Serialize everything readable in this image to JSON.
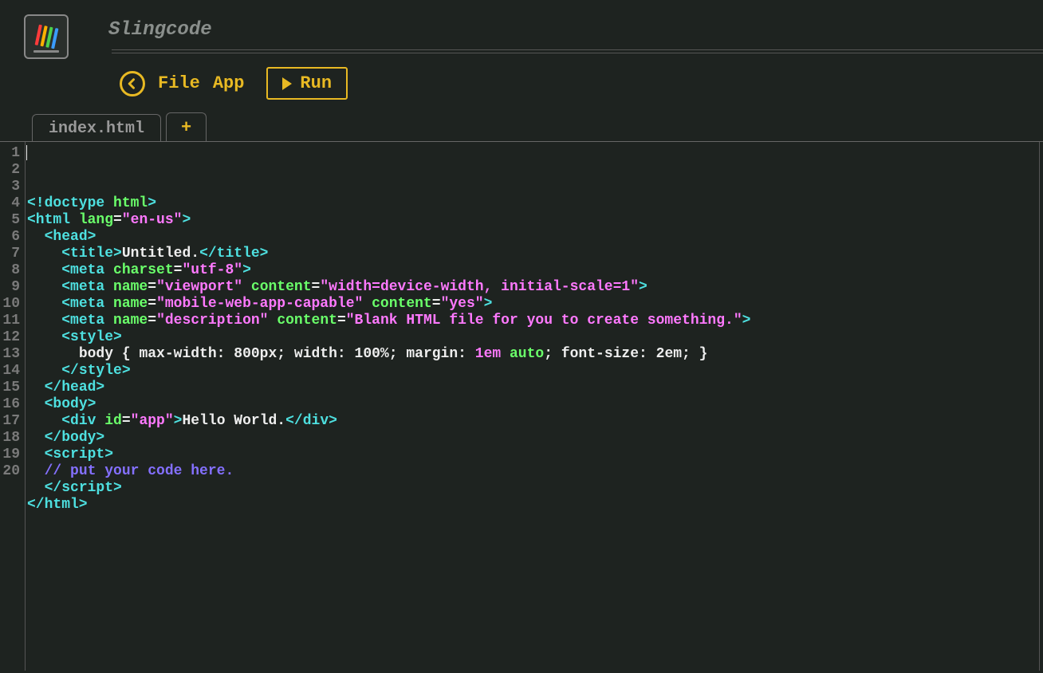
{
  "app": {
    "title": "Slingcode",
    "logo_colors": [
      "#ff3b3b",
      "#ffb000",
      "#4cd24c",
      "#3b9cff"
    ]
  },
  "toolbar": {
    "menu": {
      "file": "File",
      "app": "App"
    },
    "run_label": "Run"
  },
  "tabs": {
    "items": [
      {
        "label": "index.html",
        "active": true
      }
    ],
    "add_label": "+"
  },
  "editor": {
    "line_count": 20,
    "code_lines": [
      {
        "tokens": [
          {
            "t": "<!doctype ",
            "c": "tag"
          },
          {
            "t": "html",
            "c": "attr"
          },
          {
            "t": ">",
            "c": "tag"
          }
        ]
      },
      {
        "tokens": [
          {
            "t": "<html ",
            "c": "tag"
          },
          {
            "t": "lang",
            "c": "attr"
          },
          {
            "t": "=",
            "c": "text"
          },
          {
            "t": "\"en-us\"",
            "c": "str"
          },
          {
            "t": ">",
            "c": "tag"
          }
        ]
      },
      {
        "indent": 1,
        "tokens": [
          {
            "t": "<head>",
            "c": "tag"
          }
        ]
      },
      {
        "indent": 2,
        "tokens": [
          {
            "t": "<title>",
            "c": "tag"
          },
          {
            "t": "Untitled.",
            "c": "text"
          },
          {
            "t": "</title>",
            "c": "tag"
          }
        ]
      },
      {
        "indent": 2,
        "tokens": [
          {
            "t": "<meta ",
            "c": "tag"
          },
          {
            "t": "charset",
            "c": "attr"
          },
          {
            "t": "=",
            "c": "text"
          },
          {
            "t": "\"utf-8\"",
            "c": "str"
          },
          {
            "t": ">",
            "c": "tag"
          }
        ]
      },
      {
        "indent": 2,
        "tokens": [
          {
            "t": "<meta ",
            "c": "tag"
          },
          {
            "t": "name",
            "c": "attr"
          },
          {
            "t": "=",
            "c": "text"
          },
          {
            "t": "\"viewport\"",
            "c": "str"
          },
          {
            "t": " ",
            "c": "text"
          },
          {
            "t": "content",
            "c": "attr"
          },
          {
            "t": "=",
            "c": "text"
          },
          {
            "t": "\"width=device-width, initial-scale=1\"",
            "c": "str"
          },
          {
            "t": ">",
            "c": "tag"
          }
        ]
      },
      {
        "indent": 2,
        "tokens": [
          {
            "t": "<meta ",
            "c": "tag"
          },
          {
            "t": "name",
            "c": "attr"
          },
          {
            "t": "=",
            "c": "text"
          },
          {
            "t": "\"mobile-web-app-capable\"",
            "c": "str"
          },
          {
            "t": " ",
            "c": "text"
          },
          {
            "t": "content",
            "c": "attr"
          },
          {
            "t": "=",
            "c": "text"
          },
          {
            "t": "\"yes\"",
            "c": "str"
          },
          {
            "t": ">",
            "c": "tag"
          }
        ]
      },
      {
        "indent": 2,
        "tokens": [
          {
            "t": "<meta ",
            "c": "tag"
          },
          {
            "t": "name",
            "c": "attr"
          },
          {
            "t": "=",
            "c": "text"
          },
          {
            "t": "\"description\"",
            "c": "str"
          },
          {
            "t": " ",
            "c": "text"
          },
          {
            "t": "content",
            "c": "attr"
          },
          {
            "t": "=",
            "c": "text"
          },
          {
            "t": "\"Blank HTML file for you to create something.\"",
            "c": "str"
          },
          {
            "t": ">",
            "c": "tag"
          }
        ]
      },
      {
        "indent": 2,
        "tokens": [
          {
            "t": "<style>",
            "c": "tag"
          }
        ]
      },
      {
        "indent": 3,
        "tokens": [
          {
            "t": "body",
            "c": "text"
          },
          {
            "t": " { ",
            "c": "text"
          },
          {
            "t": "max-width",
            "c": "text"
          },
          {
            "t": ": ",
            "c": "text"
          },
          {
            "t": "800px",
            "c": "text"
          },
          {
            "t": "; ",
            "c": "text"
          },
          {
            "t": "width",
            "c": "text"
          },
          {
            "t": ": ",
            "c": "text"
          },
          {
            "t": "100%",
            "c": "text"
          },
          {
            "t": "; ",
            "c": "text"
          },
          {
            "t": "margin",
            "c": "text"
          },
          {
            "t": ": ",
            "c": "text"
          },
          {
            "t": "1em",
            "c": "num"
          },
          {
            "t": " ",
            "c": "text"
          },
          {
            "t": "auto",
            "c": "keyword"
          },
          {
            "t": "; ",
            "c": "text"
          },
          {
            "t": "font-size",
            "c": "text"
          },
          {
            "t": ": ",
            "c": "text"
          },
          {
            "t": "2em",
            "c": "text"
          },
          {
            "t": "; }",
            "c": "text"
          }
        ]
      },
      {
        "indent": 2,
        "tokens": [
          {
            "t": "</style>",
            "c": "tag"
          }
        ]
      },
      {
        "indent": 1,
        "tokens": [
          {
            "t": "</head>",
            "c": "tag"
          }
        ]
      },
      {
        "indent": 1,
        "tokens": [
          {
            "t": "<body>",
            "c": "tag"
          }
        ]
      },
      {
        "indent": 2,
        "tokens": [
          {
            "t": "<div ",
            "c": "tag"
          },
          {
            "t": "id",
            "c": "attr"
          },
          {
            "t": "=",
            "c": "text"
          },
          {
            "t": "\"app\"",
            "c": "str"
          },
          {
            "t": ">",
            "c": "tag"
          },
          {
            "t": "Hello World.",
            "c": "text"
          },
          {
            "t": "</div>",
            "c": "tag"
          }
        ]
      },
      {
        "indent": 1,
        "tokens": [
          {
            "t": "</body>",
            "c": "tag"
          }
        ]
      },
      {
        "indent": 1,
        "tokens": [
          {
            "t": "<script>",
            "c": "tag"
          }
        ]
      },
      {
        "indent": 1,
        "tokens": [
          {
            "t": "// put your code here.",
            "c": "comment"
          }
        ]
      },
      {
        "indent": 1,
        "tokens": [
          {
            "t": "</script>",
            "c": "tag"
          }
        ]
      },
      {
        "tokens": [
          {
            "t": "</html>",
            "c": "tag"
          }
        ]
      },
      {
        "tokens": []
      }
    ]
  }
}
